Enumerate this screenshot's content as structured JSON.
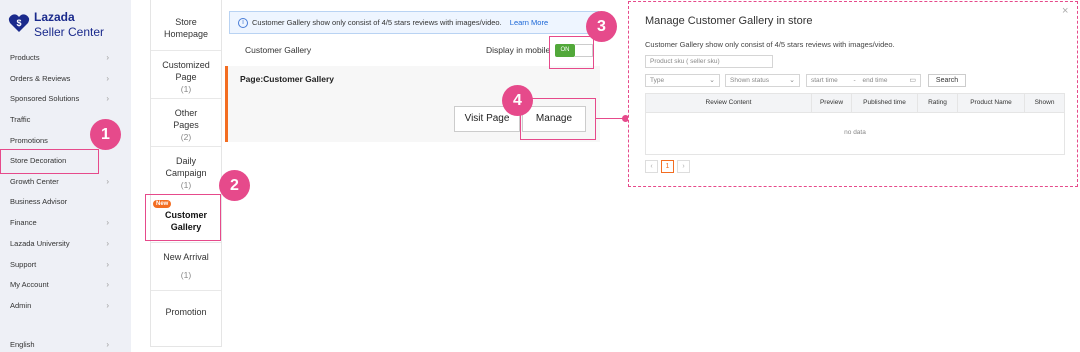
{
  "brand": {
    "name": "Lazada",
    "product": "Seller Center"
  },
  "sidebar": {
    "items": [
      {
        "label": "Products",
        "chevron": true
      },
      {
        "label": "Orders & Reviews",
        "chevron": true
      },
      {
        "label": "Sponsored Solutions",
        "chevron": true
      },
      {
        "label": "Traffic",
        "chevron": false
      },
      {
        "label": "Promotions",
        "chevron": true
      },
      {
        "label": "Store Decoration",
        "chevron": false
      },
      {
        "label": "Growth Center",
        "chevron": true
      },
      {
        "label": "Business Advisor",
        "chevron": false
      },
      {
        "label": "Finance",
        "chevron": true
      },
      {
        "label": "Lazada University",
        "chevron": true
      },
      {
        "label": "Support",
        "chevron": true
      },
      {
        "label": "My Account",
        "chevron": true
      },
      {
        "label": "Admin",
        "chevron": true
      }
    ],
    "language": {
      "label": "English",
      "chevron": true
    }
  },
  "subnav": {
    "items": [
      {
        "label": "Store Homepage",
        "lines": [
          "Store",
          "Homepage"
        ],
        "count": ""
      },
      {
        "label": "Customized Page",
        "lines": [
          "Customized",
          "Page"
        ],
        "count": "(1)"
      },
      {
        "label": "Other Pages",
        "lines": [
          "Other",
          "Pages"
        ],
        "count": "(2)"
      },
      {
        "label": "Daily Campaign",
        "lines": [
          "Daily",
          "Campaign"
        ],
        "count": "(1)"
      },
      {
        "label": "Customer Gallery",
        "lines": [
          "Customer",
          "Gallery"
        ],
        "count": "",
        "badge": "New"
      },
      {
        "label": "New Arrival",
        "lines": [
          "New Arrival"
        ],
        "count": "(1)"
      },
      {
        "label": "Promotion",
        "lines": [
          "Promotion"
        ],
        "count": ""
      }
    ]
  },
  "notice": {
    "text": "Customer Gallery show only consist of 4/5 stars reviews with images/video.",
    "link": "Learn More"
  },
  "gallery": {
    "label": "Customer Gallery",
    "mobile_label": "Display in mobile",
    "toggle_label": "ON",
    "page_title": "Page:Customer Gallery",
    "visit_button": "Visit Page",
    "manage_button": "Manage"
  },
  "steps": [
    "1",
    "2",
    "3",
    "4"
  ],
  "modal": {
    "title": "Manage Customer Gallery in store",
    "close": "×",
    "subtitle": "Customer Gallery show only consist of 4/5 stars reviews with images/video.",
    "sku_placeholder": "Product sku ( seller sku)",
    "type_placeholder": "Type",
    "status_placeholder": "Shown status",
    "start_placeholder": "start time",
    "separator": "-",
    "end_placeholder": "end time",
    "search_button": "Search",
    "columns": [
      "Review Content",
      "Preview",
      "Published time",
      "Rating",
      "Product Name",
      "Shown"
    ],
    "empty_text": "no data",
    "pager": {
      "prev": "‹",
      "page": "1",
      "next": "›"
    }
  },
  "colors": {
    "accent": "#e64a8b",
    "brand": "#1a2a8c",
    "orange": "#f36d21",
    "toggle": "#52a83a"
  }
}
